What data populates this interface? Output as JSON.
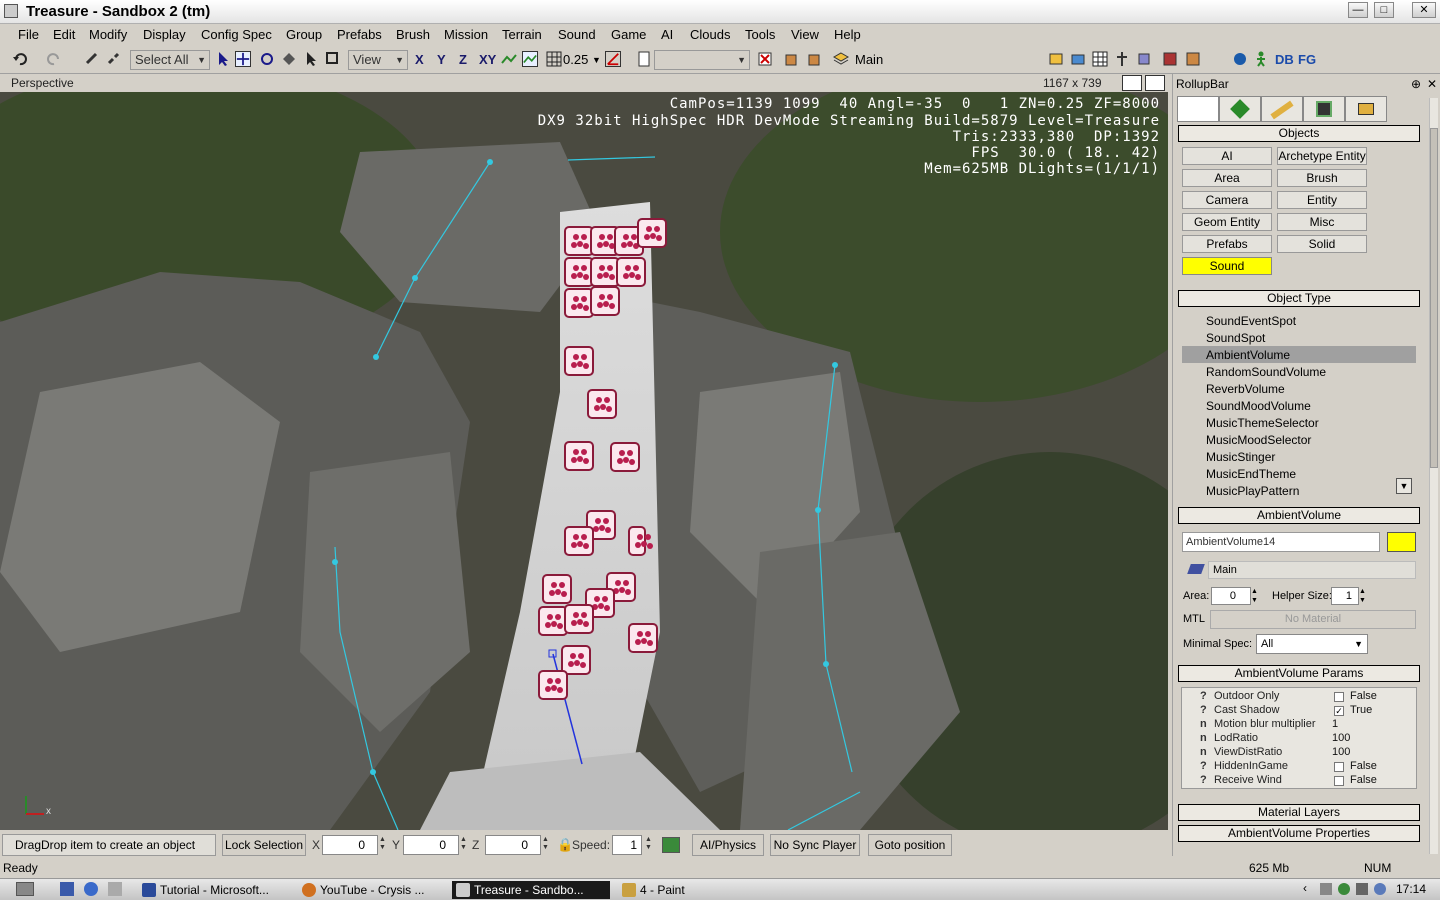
{
  "window": {
    "title": "Treasure - Sandbox 2 (tm)",
    "minimize": "—",
    "maximize": "□",
    "close": "✕"
  },
  "menu": [
    "File",
    "Edit",
    "Modify",
    "Display",
    "Config Spec",
    "Group",
    "Prefabs",
    "Brush",
    "Mission",
    "Terrain",
    "Sound",
    "Game",
    "AI",
    "Clouds",
    "Tools",
    "View",
    "Help"
  ],
  "toolbar": {
    "select_mode": "Select All",
    "ref_coord": "View",
    "axis_x": "X",
    "axis_y": "Y",
    "axis_z": "Z",
    "axis_xy": "XY",
    "grid_size": "0.25",
    "layer": "Main",
    "db": "DB",
    "fg": "FG"
  },
  "viewport": {
    "label": "Perspective",
    "resolution": "1167 x 739",
    "info_lines": [
      "CamPos=1139 1099  40 Angl=-35  0   1 ZN=0.25 ZF=8000",
      "DX9 32bit HighSpec HDR DevMode Streaming Build=5879 Level=Treasure",
      "Tris:2333,380  DP:1392",
      "FPS  30.0 ( 18.. 42)",
      "Mem=625MB DLights=(1/1/1)"
    ],
    "axis_x": "x"
  },
  "rollup": {
    "title": "RollupBar",
    "pin": "⊕",
    "close": "✕",
    "objects_title": "Objects",
    "object_buttons": [
      "AI",
      "Archetype Entity",
      "Area",
      "Brush",
      "Camera",
      "Entity",
      "Geom Entity",
      "Misc",
      "Prefabs",
      "Solid",
      "Sound"
    ],
    "active_button": "Sound",
    "object_type_title": "Object Type",
    "object_types": [
      "SoundEventSpot",
      "SoundSpot",
      "AmbientVolume",
      "RandomSoundVolume",
      "ReverbVolume",
      "SoundMoodVolume",
      "MusicThemeSelector",
      "MusicMoodSelector",
      "MusicStinger",
      "MusicEndTheme",
      "MusicPlayPattern"
    ],
    "selected_type": "AmbientVolume",
    "ambient_title": "AmbientVolume",
    "object_name": "AmbientVolume14",
    "object_color": "#ffff00",
    "layer": "Main",
    "area_label": "Area:",
    "area_value": "0",
    "helper_label": "Helper Size:",
    "helper_value": "1",
    "mtl_label": "MTL",
    "mtl_value": "No Material",
    "minspec_label": "Minimal Spec:",
    "minspec_value": "All",
    "params_title": "AmbientVolume Params",
    "params": [
      {
        "q": "?",
        "name": "Outdoor Only",
        "checked": false,
        "value": "False"
      },
      {
        "q": "?",
        "name": "Cast Shadow",
        "checked": true,
        "value": "True"
      },
      {
        "q": "n",
        "name": "Motion blur multiplier",
        "value": "1"
      },
      {
        "q": "n",
        "name": "LodRatio",
        "value": "100"
      },
      {
        "q": "n",
        "name": "ViewDistRatio",
        "value": "100"
      },
      {
        "q": "?",
        "name": "HiddenInGame",
        "checked": false,
        "value": "False"
      },
      {
        "q": "?",
        "name": "Receive Wind",
        "checked": false,
        "value": "False"
      }
    ],
    "material_layers": "Material Layers",
    "props_title": "AmbientVolume Properties"
  },
  "bottom": {
    "hint": "DragDrop item to create an object",
    "lock_selection": "Lock Selection",
    "x_label": "X",
    "x_value": "0",
    "y_label": "Y",
    "y_value": "0",
    "z_label": "Z",
    "z_value": "0",
    "speed_label": "Speed:",
    "speed_value": "1",
    "ai_physics": "AI/Physics",
    "no_sync": "No Sync Player",
    "goto": "Goto position"
  },
  "status": {
    "text": "Ready",
    "memory": "625 Mb",
    "num": "NUM"
  },
  "taskbar": {
    "tasks": [
      "Tutorial - Microsoft...",
      "YouTube - Crysis ...",
      "Treasure - Sandbo...",
      "4 - Paint"
    ],
    "active": "Treasure - Sandbo...",
    "clock": "17:14"
  }
}
